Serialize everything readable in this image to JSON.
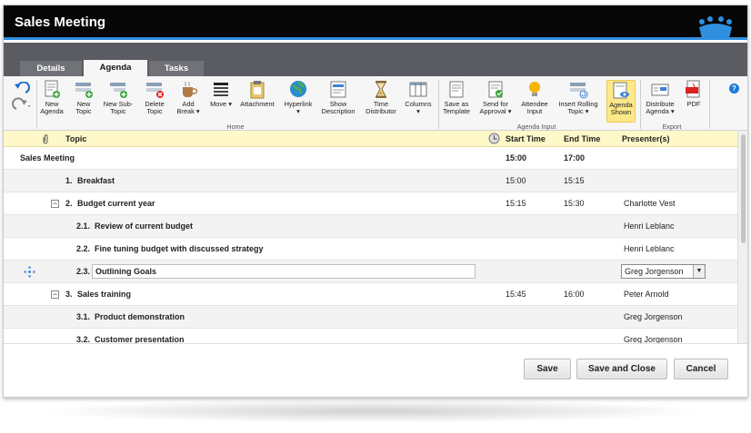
{
  "window": {
    "title": "Sales Meeting"
  },
  "tabs": [
    {
      "label": "Details"
    },
    {
      "label": "Agenda"
    },
    {
      "label": "Tasks"
    }
  ],
  "ribbon": {
    "buttons": [
      {
        "label": "New Agenda"
      },
      {
        "label": "New Topic"
      },
      {
        "label": "New Sub-Topic"
      },
      {
        "label": "Delete Topic"
      },
      {
        "label": "Add Break ▾"
      },
      {
        "label": "Move ▾"
      },
      {
        "label": "Attachment"
      },
      {
        "label": "Hyperlink ▾"
      },
      {
        "label": "Show Description"
      },
      {
        "label": "Time Distributor"
      },
      {
        "label": "Columns ▾"
      },
      {
        "label": "Save as Template"
      },
      {
        "label": "Send for Approval ▾"
      },
      {
        "label": "Attendee Input"
      },
      {
        "label": "Insert Rolling Topic ▾"
      },
      {
        "label": "Agenda Shown"
      },
      {
        "label": "Distribute Agenda ▾"
      },
      {
        "label": "PDF"
      }
    ],
    "groups": {
      "home": "Home",
      "agenda_input": "Agenda Input",
      "export": "Export"
    }
  },
  "columns": {
    "topic": "Topic",
    "start": "Start Time",
    "end": "End Time",
    "presenter": "Presenter(s)"
  },
  "rows": [
    {
      "num": "",
      "topic": "Sales Meeting",
      "start": "15:00",
      "end": "17:00",
      "presenter": ""
    },
    {
      "num": "1.",
      "topic": "Breakfast",
      "start": "15:00",
      "end": "15:15",
      "presenter": ""
    },
    {
      "num": "2.",
      "topic": "Budget current year",
      "start": "15:15",
      "end": "15:30",
      "presenter": "Charlotte Vest"
    },
    {
      "num": "2.1.",
      "topic": "Review of current budget",
      "start": "",
      "end": "",
      "presenter": "Henri Leblanc"
    },
    {
      "num": "2.2.",
      "topic": "Fine tuning budget with discussed strategy",
      "start": "",
      "end": "",
      "presenter": "Henri Leblanc"
    },
    {
      "num": "2.3.",
      "topic": "Outlining Goals",
      "start": "",
      "end": "",
      "presenter": "Greg Jorgenson"
    },
    {
      "num": "3.",
      "topic": "Sales training",
      "start": "15:45",
      "end": "16:00",
      "presenter": "Peter Arnold"
    },
    {
      "num": "3.1.",
      "topic": "Product demonstration",
      "start": "",
      "end": "",
      "presenter": "Greg Jorgenson"
    },
    {
      "num": "3.2.",
      "topic": "Customer presentation",
      "start": "",
      "end": "",
      "presenter": "Greg Jorgenson"
    }
  ],
  "footer": {
    "save": "Save",
    "save_close": "Save and Close",
    "cancel": "Cancel"
  },
  "colors": {
    "accent": "#2f8fe0",
    "header_bg": "#fff8c8",
    "selected_button": "#fde98a"
  }
}
